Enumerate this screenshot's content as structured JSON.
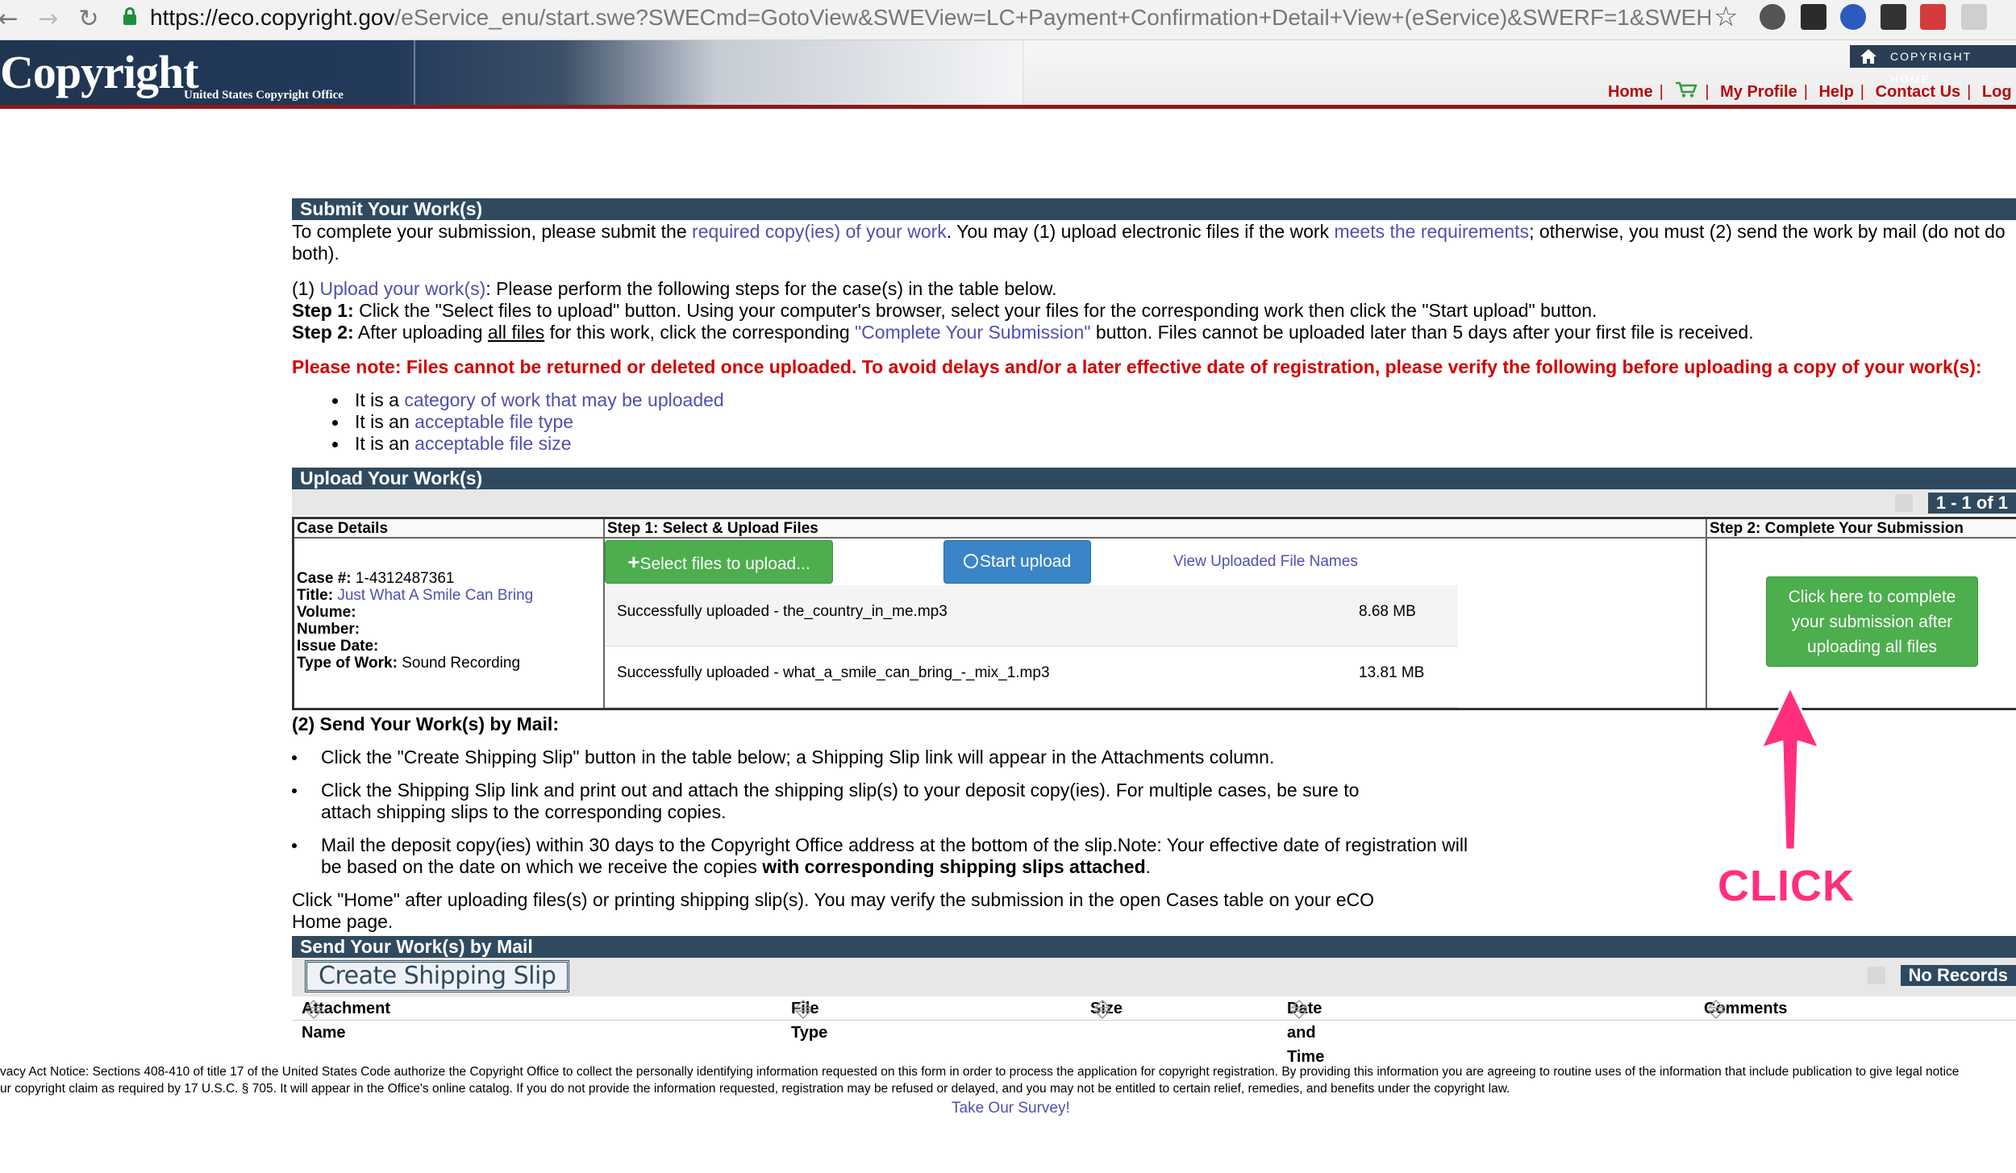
{
  "browser": {
    "url_host": "https://eco.copyright.gov",
    "url_rest": "/eService_enu/start.swe?SWECmd=GotoView&SWEView=LC+Payment+Confirmation+Detail+View+(eService)&SWERF=1&SWEHo=eco.copyr..."
  },
  "header": {
    "logo": "Copyright",
    "logo_sub": "United States Copyright Office",
    "copyright_home": "COPYRIGHT HOME",
    "nav": [
      "Home",
      "My Profile",
      "Help",
      "Contact Us",
      "Log Out"
    ]
  },
  "submit": {
    "title": "Submit Your Work(s)",
    "intro_1": "To complete your submission, please submit the ",
    "intro_link_1": "required copy(ies) of your work",
    "intro_2": ". You may (1) upload electronic files if the work ",
    "intro_link_2": "meets the requirements",
    "intro_3": "; otherwise, you must (2) send the work by mail (do not do both).",
    "upload_prefix": "(1) ",
    "upload_link": "Upload your work(s)",
    "upload_suffix": ": Please perform the following steps for the case(s) in the table below.",
    "step1_label": "Step 1:",
    "step1_text": " Click the \"Select files to upload\" button. Using your computer's browser, select your files for the corresponding work then click the \"Start upload\" button.",
    "step2_label": "Step 2:",
    "step2_a": " After uploading ",
    "step2_underline": "all files",
    "step2_b": " for this work, click the corresponding ",
    "step2_link": "\"Complete Your Submission\"",
    "step2_c": " button. Files cannot be uploaded later than 5 days after your first file is received.",
    "note": "Please note: Files cannot be returned or deleted once uploaded. To avoid delays and/or a later effective date of registration, please verify the following before uploading a copy of your work(s):",
    "requirements": [
      {
        "prefix": "It is a ",
        "link": "category of work that may be uploaded"
      },
      {
        "prefix": "It is an ",
        "link": "acceptable file type"
      },
      {
        "prefix": "It is an ",
        "link": "acceptable file size"
      }
    ]
  },
  "upload": {
    "title": "Upload Your Work(s)",
    "pager": "1 - 1 of 1",
    "col_case": "Case Details",
    "col_step1": "Step 1: Select & Upload Files",
    "col_step2": "Step 2: Complete Your Submission",
    "case_label": "Case #:",
    "case_value": " 1-4312487361",
    "title_label": "Title:",
    "title_value": "Just What A Smile Can Bring",
    "volume_label": "Volume:",
    "number_label": "Number:",
    "issue_label": "Issue Date:",
    "type_label": "Type of Work:",
    "type_value": " Sound Recording",
    "select_btn": "Select files to upload...",
    "start_btn": "Start upload",
    "view_link": "View Uploaded File Names",
    "files": [
      {
        "name": "Successfully uploaded - the_country_in_me.mp3",
        "size": "8.68 MB"
      },
      {
        "name": "Successfully uploaded - what_a_smile_can_bring_-_mix_1.mp3",
        "size": "13.81 MB"
      }
    ],
    "complete_btn": "Click here to complete your submission after uploading all files"
  },
  "mail": {
    "heading": "(2) Send Your Work(s) by Mail:",
    "steps": [
      "Click the \"Create Shipping Slip\" button in the table below; a Shipping Slip link will appear in the Attachments column.",
      "Click the Shipping Slip link and print out and attach the shipping slip(s) to your deposit copy(ies). For multiple cases, be sure to attach shipping slips to the corresponding copies."
    ],
    "step3_a": "Mail the deposit copy(ies) within 30 days to the Copyright Office address at the bottom of the slip.Note: Your effective date of registration will be based on the date on which we receive the copies ",
    "step3_bold": "with corresponding shipping slips attached",
    "step3_end": ".",
    "home_note": "Click \"Home\" after uploading files(s) or printing shipping slip(s). You may verify the submission in the open Cases table on your eCO Home page.",
    "bar_title": "Send Your Work(s) by Mail",
    "create_btn": "Create Shipping Slip",
    "no_records": "No Records",
    "columns": [
      "Attachment Name",
      "File Type",
      "Size",
      "Date and Time",
      "Comments"
    ]
  },
  "footer": {
    "privacy_1": "vacy Act Notice: Sections 408-410 of title 17 of the United States Code authorize the Copyright Office to collect the personally identifying information requested on this form in order to process the application for copyright registration. By providing this information you are agreeing to routine uses of the information that include publication to give legal notice",
    "privacy_2": "ur copyright claim as required by 17 U.S.C. § 705. It will appear in the Office's online catalog. If you do not provide the information requested, registration may be refused or delayed, and you may not be entitled to certain relief, remedies, and benefits under the copyright law.",
    "survey": "Take Our Survey!"
  },
  "annotation": {
    "label": "CLICK",
    "color": "#ff2f7d"
  }
}
